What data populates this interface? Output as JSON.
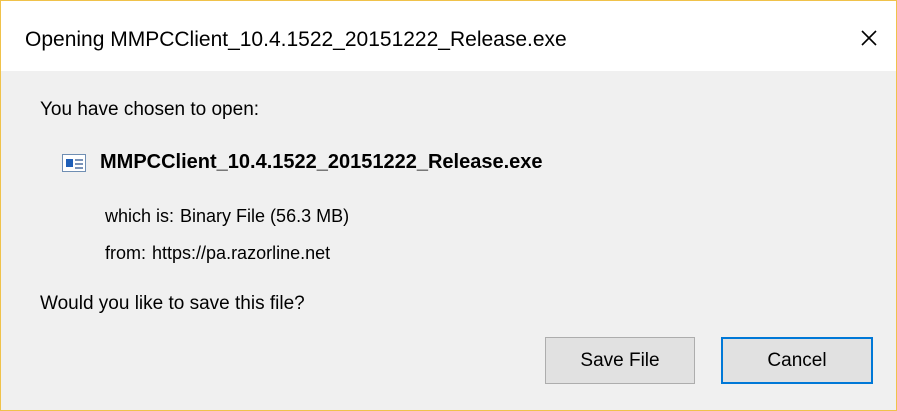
{
  "window": {
    "title": "Opening MMPCClient_10.4.1522_20151222_Release.exe",
    "close_symbol": "✕",
    "close_icon": "close-icon",
    "accent_border": "#f0c24a"
  },
  "dialog": {
    "prompt": "You have chosen to open:",
    "file": {
      "icon": "executable-file-icon",
      "name": "MMPCClient_10.4.1522_20151222_Release.exe"
    },
    "which_is_label": "which is:",
    "which_is_value": "Binary File (56.3 MB)",
    "from_label": "from:",
    "from_value": "https://pa.razorline.net",
    "question": "Would you like to save this file?"
  },
  "buttons": {
    "save_label": "Save File",
    "cancel_label": "Cancel",
    "default_focus_color": "#0078d7"
  }
}
